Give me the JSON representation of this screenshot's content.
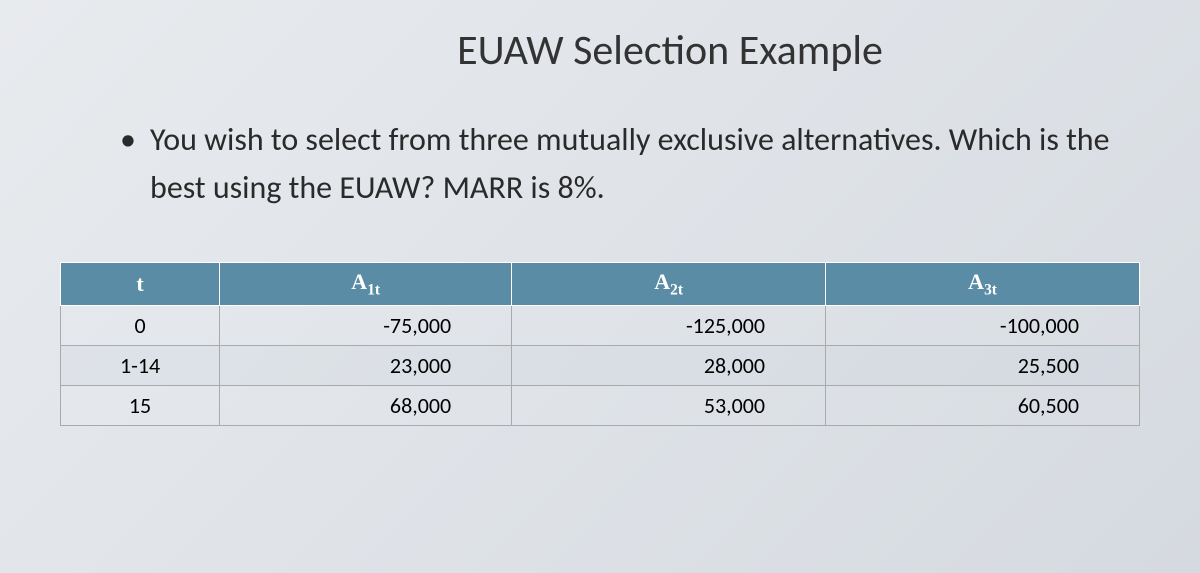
{
  "title": "EUAW Selection Example",
  "bullet_text": "You wish to select from three mutually exclusive alternatives.  Which is the best using the EUAW? MARR is 8%.",
  "table": {
    "headers": {
      "col0": "t",
      "col1_base": "A",
      "col1_sub": "1t",
      "col2_base": "A",
      "col2_sub": "2t",
      "col3_base": "A",
      "col3_sub": "3t"
    },
    "rows": [
      {
        "t": "0",
        "a1": "-75,000",
        "a2": "-125,000",
        "a3": "-100,000"
      },
      {
        "t": "1-14",
        "a1": "23,000",
        "a2": "28,000",
        "a3": "25,500"
      },
      {
        "t": "15",
        "a1": "68,000",
        "a2": "53,000",
        "a3": "60,500"
      }
    ]
  },
  "chart_data": {
    "type": "table",
    "columns": [
      "t",
      "A1t",
      "A2t",
      "A3t"
    ],
    "rows": [
      [
        "0",
        -75000,
        -125000,
        -100000
      ],
      [
        "1-14",
        23000,
        28000,
        25500
      ],
      [
        "15",
        68000,
        53000,
        60500
      ]
    ],
    "title": "EUAW Selection Example",
    "context": "MARR = 8%"
  }
}
